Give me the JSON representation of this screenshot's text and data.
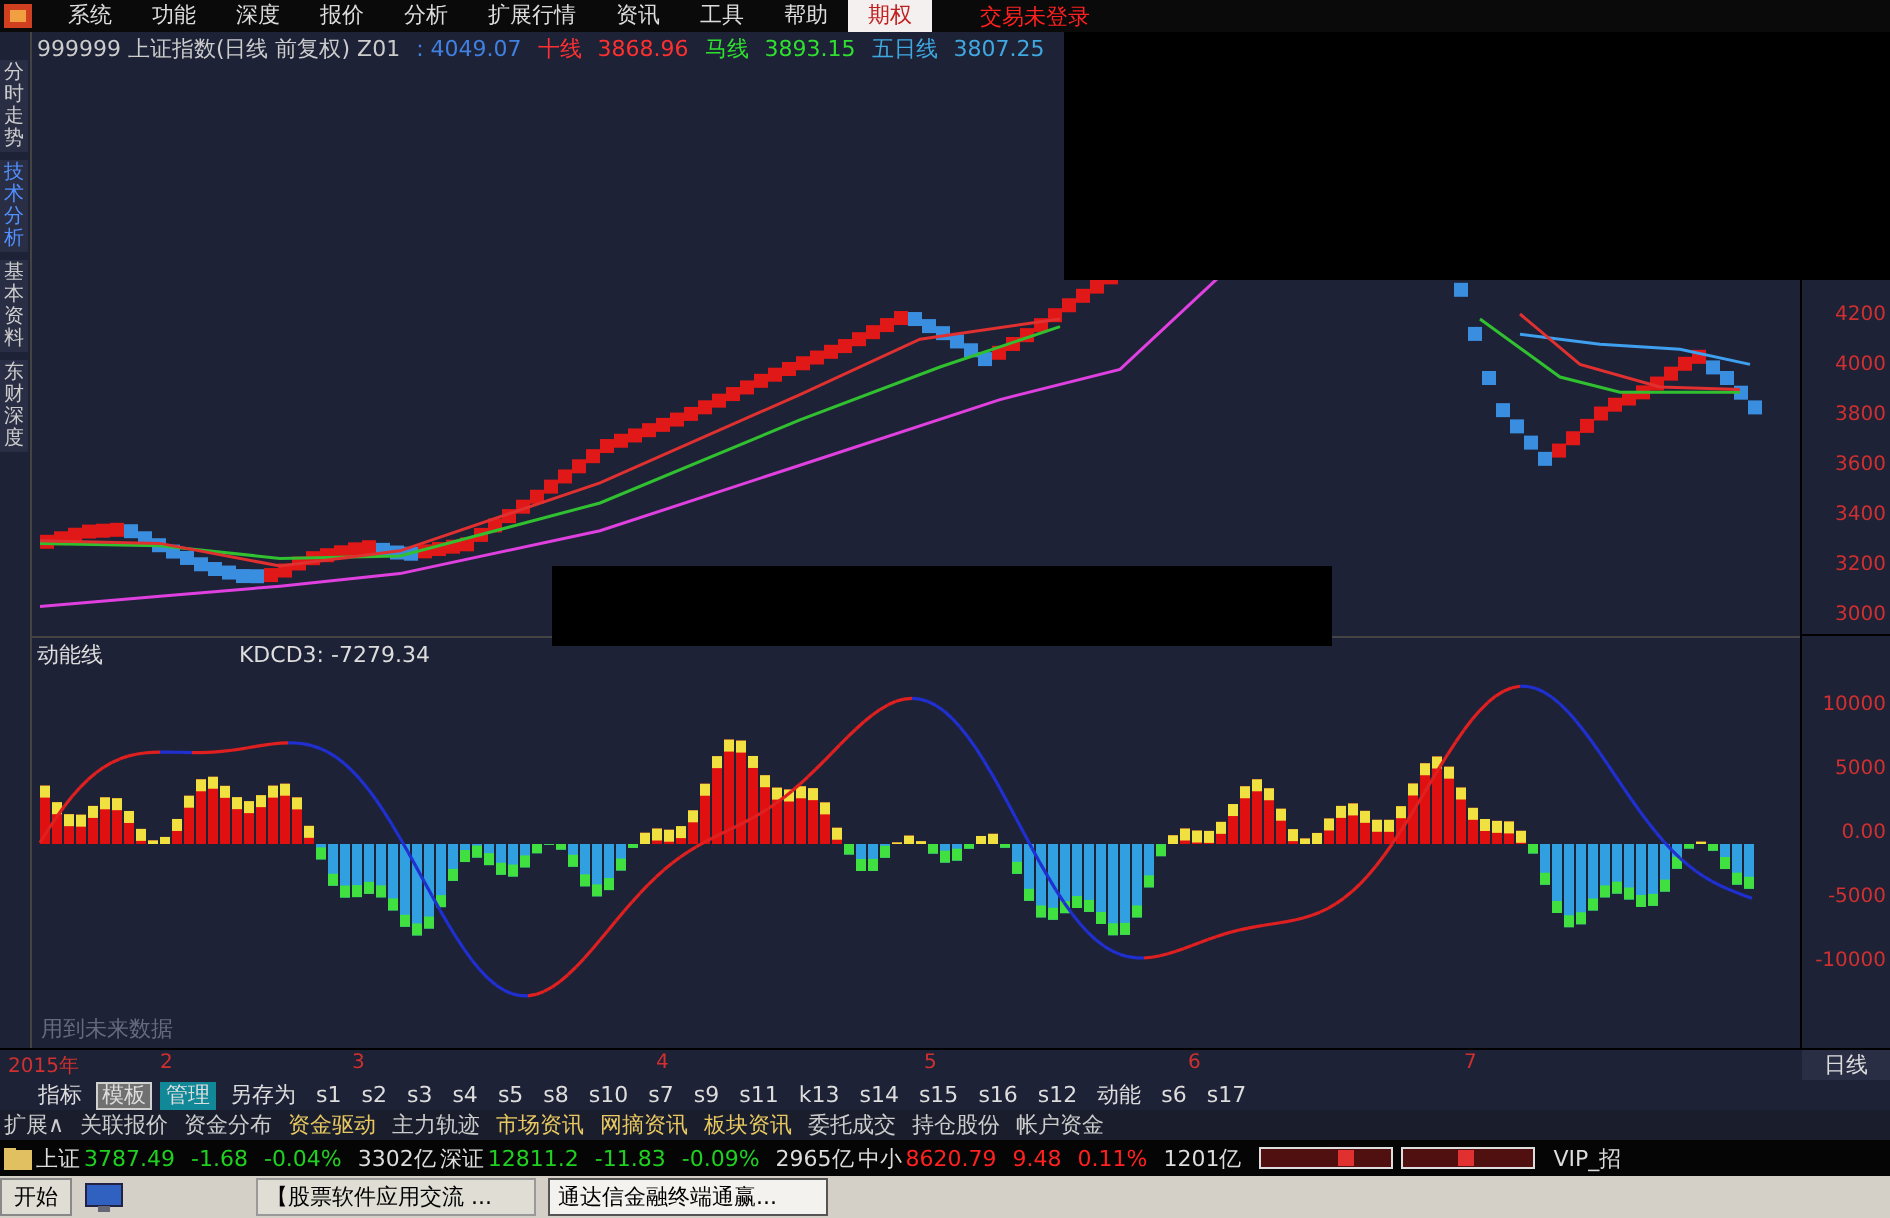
{
  "menu": [
    {
      "label": "系统",
      "selected": false
    },
    {
      "label": "功能",
      "selected": false
    },
    {
      "label": "深度",
      "selected": false
    },
    {
      "label": "报价",
      "selected": false
    },
    {
      "label": "分析",
      "selected": false
    },
    {
      "label": "扩展行情",
      "selected": false
    },
    {
      "label": "资讯",
      "selected": false
    },
    {
      "label": "工具",
      "selected": false
    },
    {
      "label": "帮助",
      "selected": false
    },
    {
      "label": "期权",
      "selected": true
    }
  ],
  "login_status": "交易未登录",
  "vertical_tabs": [
    {
      "label": "分时走势",
      "selected": false
    },
    {
      "label": "技术分析",
      "selected": true
    },
    {
      "label": "基本资料",
      "selected": false
    },
    {
      "label": "东财深度",
      "selected": false
    }
  ],
  "chart_header": {
    "symbol": "999999 上证指数(日线 前复权) Z01",
    "value": ": 4049.07",
    "lines": [
      {
        "name": "十线",
        "value": "3868.96",
        "color": "#ff3030"
      },
      {
        "name": "马线",
        "value": "3893.15",
        "color": "#30e030"
      },
      {
        "name": "五日线",
        "value": "3807.25",
        "color": "#40a8e0"
      }
    ]
  },
  "price_axis": [
    "4200",
    "4000",
    "3800",
    "3600",
    "3400",
    "3200",
    "3000"
  ],
  "indicator": {
    "name": "动能线",
    "reading": "KDCD3: -7279.34",
    "note": "用到未来数据"
  },
  "indicator_axis": [
    "10000",
    "5000",
    "0.00",
    "-5000",
    "-10000"
  ],
  "period": "日线",
  "dates": [
    "2015年",
    "2",
    "3",
    "4",
    "5",
    "6",
    "7"
  ],
  "formula_tabs": [
    {
      "label": "指标",
      "selected": false,
      "highlighted": false
    },
    {
      "label": "模板",
      "selected": true,
      "highlighted": false
    },
    {
      "label": "管理",
      "selected": false,
      "highlighted": true
    },
    {
      "label": "另存为",
      "selected": false,
      "highlighted": false
    },
    {
      "label": "s1",
      "selected": false,
      "highlighted": false
    },
    {
      "label": "s2",
      "selected": false,
      "highlighted": false
    },
    {
      "label": "s3",
      "selected": false,
      "highlighted": false
    },
    {
      "label": "s4",
      "selected": false,
      "highlighted": false
    },
    {
      "label": "s5",
      "selected": false,
      "highlighted": false
    },
    {
      "label": "s8",
      "selected": false,
      "highlighted": false
    },
    {
      "label": "s10",
      "selected": false,
      "highlighted": false
    },
    {
      "label": "s7",
      "selected": false,
      "highlighted": false
    },
    {
      "label": "s9",
      "selected": false,
      "highlighted": false
    },
    {
      "label": "s11",
      "selected": false,
      "highlighted": false
    },
    {
      "label": "k13",
      "selected": false,
      "highlighted": false
    },
    {
      "label": "s14",
      "selected": false,
      "highlighted": false
    },
    {
      "label": "s15",
      "selected": false,
      "highlighted": false
    },
    {
      "label": "s16",
      "selected": false,
      "highlighted": false
    },
    {
      "label": "s12",
      "selected": false,
      "highlighted": false
    },
    {
      "label": "动能",
      "selected": false,
      "highlighted": false
    },
    {
      "label": "s6",
      "selected": false,
      "highlighted": false
    },
    {
      "label": "s17",
      "selected": false,
      "highlighted": false
    }
  ],
  "links": [
    {
      "label": "扩展∧",
      "highlighted": false
    },
    {
      "label": "关联报价",
      "highlighted": false
    },
    {
      "label": "资金分布",
      "highlighted": false
    },
    {
      "label": "资金驱动",
      "highlighted": true
    },
    {
      "label": "主力轨迹",
      "highlighted": false
    },
    {
      "label": "市场资讯",
      "highlighted": true
    },
    {
      "label": "网摘资讯",
      "highlighted": true
    },
    {
      "label": "板块资讯",
      "highlighted": true
    },
    {
      "label": "委托成交",
      "highlighted": false
    },
    {
      "label": "持仓股份",
      "highlighted": false
    },
    {
      "label": "帐户资金",
      "highlighted": false
    }
  ],
  "status_bar": [
    {
      "name": "上证",
      "price": "3787.49",
      "change": "-1.68",
      "percent": "-0.04%",
      "volume": "3302亿",
      "color": "#20d020"
    },
    {
      "name": "深证",
      "price": "12811.2",
      "change": "-11.83",
      "percent": "-0.09%",
      "volume": "2965亿",
      "color": "#20d020"
    },
    {
      "name": "中小",
      "price": "8620.79",
      "change": "9.48",
      "percent": "0.11%",
      "volume": "1201亿",
      "color": "#ff2020"
    }
  ],
  "status_extra": "VIP_招",
  "taskbar": {
    "start": "开始",
    "windows": [
      {
        "label": "【股票软件应用交流 ...",
        "selected": false
      },
      {
        "label": "通达信金融终端通赢...",
        "selected": true
      }
    ]
  }
}
